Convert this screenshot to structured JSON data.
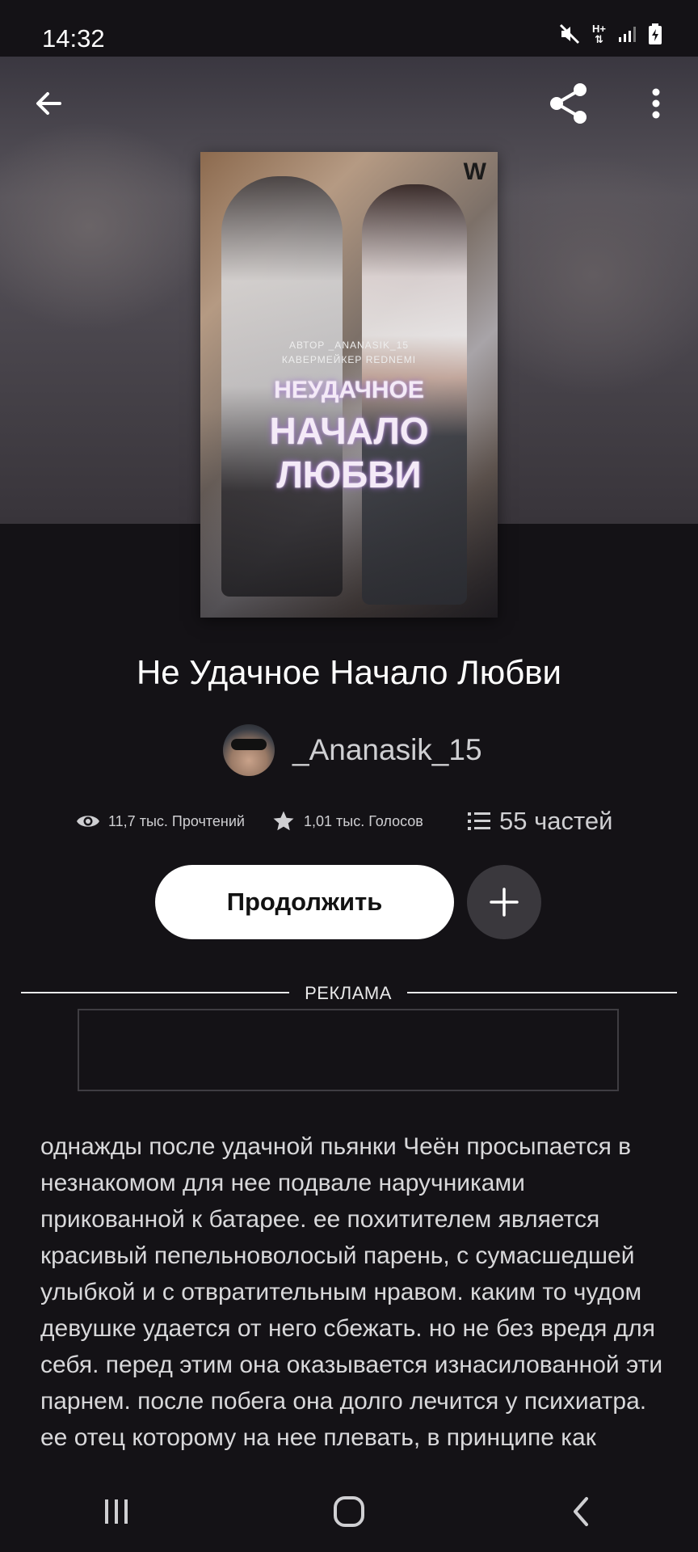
{
  "status_bar": {
    "time": "14:32",
    "network_label": "H+"
  },
  "top_bar": {
    "back_icon": "arrow-left-icon",
    "share_icon": "share-icon",
    "more_icon": "more-vertical-icon"
  },
  "cover": {
    "credit_author": "АВТОР _ANANASIK_15",
    "credit_cover": "КАВЕРМЕЙКЕР REDNEMI",
    "title_line1": "НЕУДАЧНОЕ",
    "title_line2": "НАЧАЛО",
    "title_line3": "ЛЮБВИ",
    "logo_text": "W"
  },
  "book": {
    "title": "Не Удачное Начало Любви",
    "author": "_Ananasik_15"
  },
  "stats": {
    "reads": "11,7 тыс. Прочтений",
    "votes": "1,01 тыс. Голосов",
    "parts": "55 частей"
  },
  "actions": {
    "continue_label": "Продолжить",
    "add_icon": "plus-icon"
  },
  "ad": {
    "label": "РЕКЛАМА"
  },
  "description": "однажды после удачной пьянки Чеён просыпается в незнакомом для нее подвале наручниками прикованной к батарее. ее похитителем является красивый пепельноволосый парень, с сумасшедшей улыбкой и с отвратительным нравом. каким то чудом девушке удается от него сбежать. но не без вредя для себя. перед этим она оказывается изнасилованной эти парнем. после побега она долго лечится у психиатра.\nее отец которому на нее плевать, в принципе как",
  "colors": {
    "background": "#141216",
    "continue_button": "#ffffff",
    "add_button": "#3a383d",
    "text_secondary": "#cfcfd2"
  }
}
